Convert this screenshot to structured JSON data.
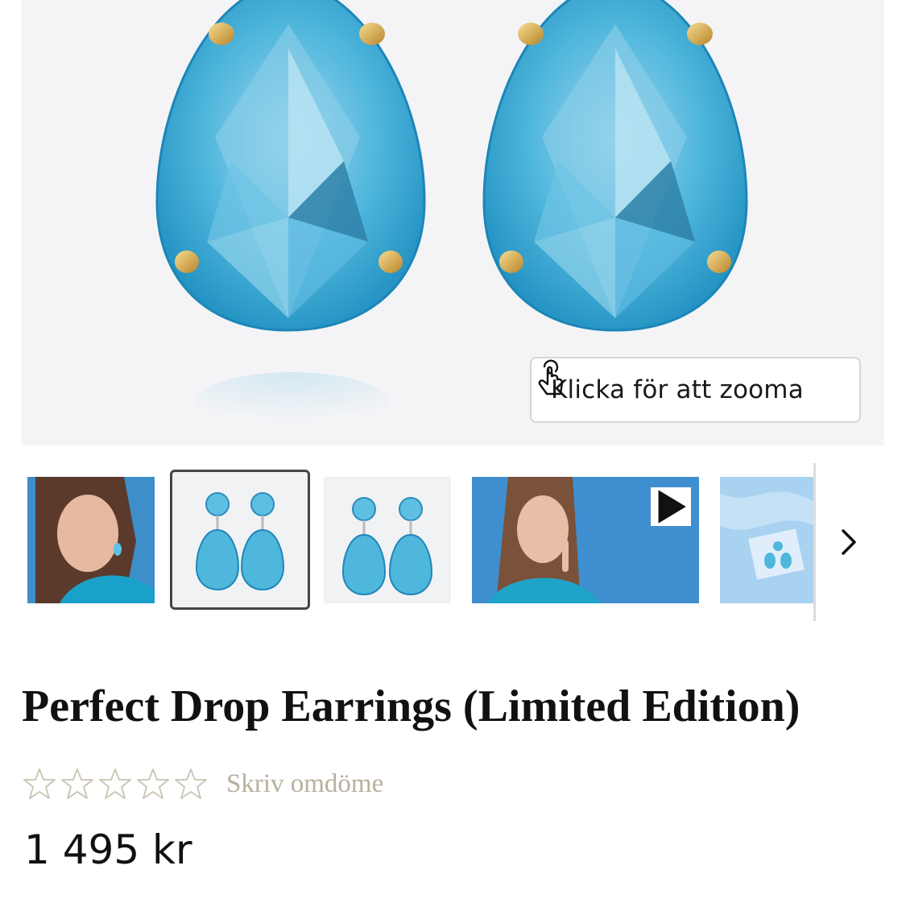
{
  "hero": {
    "zoom_label": "Klicka för att zooma",
    "zoom_icon": "tap-hand-icon"
  },
  "thumbnails": [
    {
      "name": "model-portrait",
      "selected": false
    },
    {
      "name": "earrings-front",
      "selected": true
    },
    {
      "name": "earrings-angle",
      "selected": false
    },
    {
      "name": "model-video",
      "selected": false,
      "icon": "play-icon"
    },
    {
      "name": "earrings-on-fabric",
      "selected": false
    }
  ],
  "thumb_next_icon": "chevron-right-icon",
  "product": {
    "title": "Perfect Drop Earrings (Limited Edition)",
    "rating": 0,
    "rating_max": 5,
    "review_link": "Skriv omdöme",
    "price": "1 495 kr"
  },
  "colors": {
    "crystal": "#4fb6dc",
    "gold": "#d9a94c",
    "hero_bg": "#f4f4f6",
    "star_outline": "#c9c3b3",
    "review_link": "#b7b09d"
  }
}
